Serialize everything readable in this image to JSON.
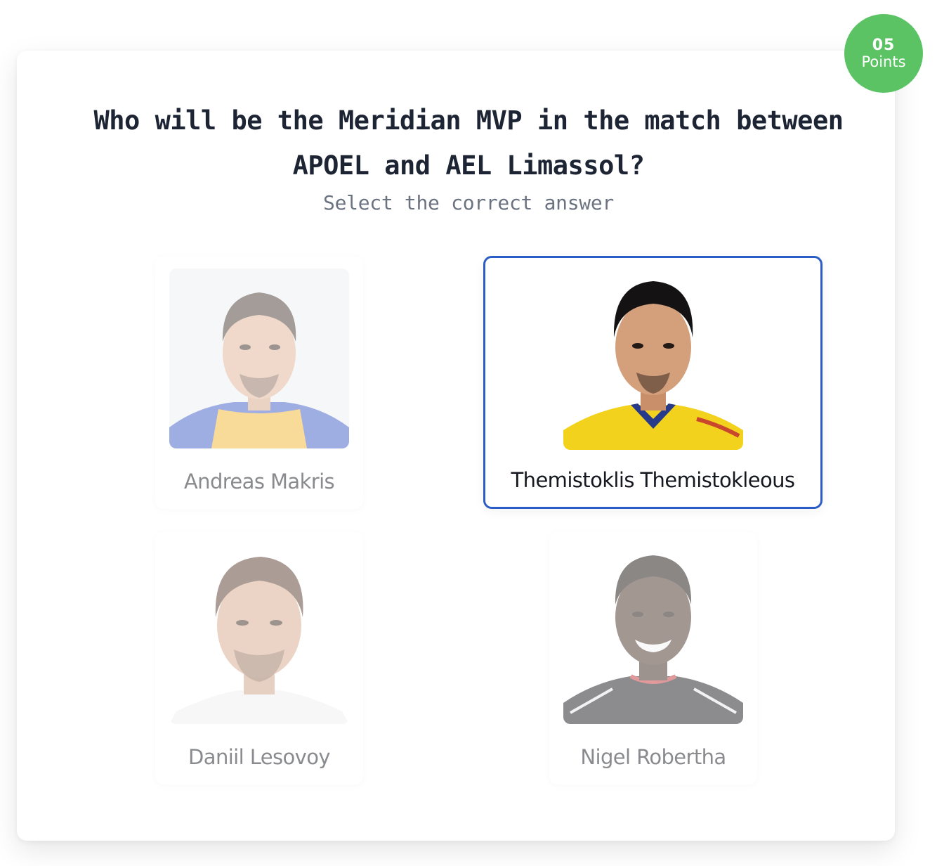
{
  "badge": {
    "value": "05",
    "label": "Points"
  },
  "question": {
    "title": "Who will be the Meridian MVP in the match between APOEL and AEL Limassol?",
    "subtitle": "Select the correct answer"
  },
  "options": [
    {
      "name": "Andreas Makris",
      "photo": "player-photo-yellow-blue-kit",
      "selected": false
    },
    {
      "name": "Themistoklis Themistokleous",
      "photo": "player-photo-yellow-kit",
      "selected": true
    },
    {
      "name": "Daniil Lesovoy",
      "photo": "player-photo-white-shirt",
      "selected": false
    },
    {
      "name": "Nigel Robertha",
      "photo": "player-photo-black-kit",
      "selected": false
    }
  ],
  "colors": {
    "badge": "#5cc365",
    "selected_border": "#2c5cc5",
    "title": "#1d2433",
    "subtitle": "#6b7280"
  }
}
